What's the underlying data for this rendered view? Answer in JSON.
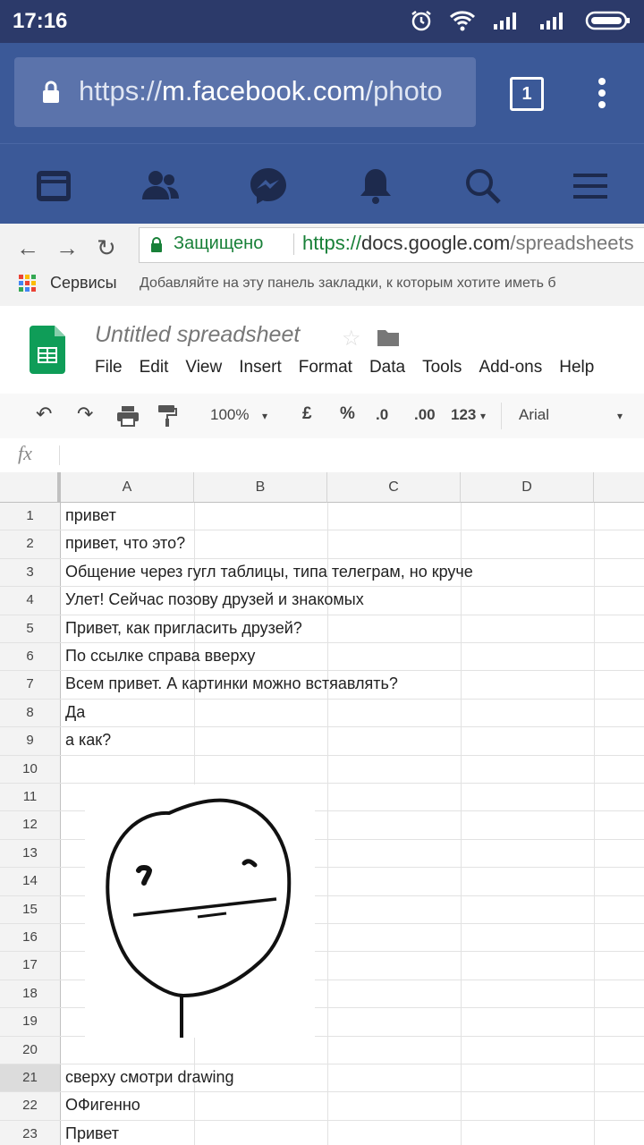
{
  "status_bar": {
    "time": "17:16"
  },
  "browser": {
    "url_prefix": "https://",
    "url_host": "m.facebook.com",
    "url_path": "/photo",
    "tab_count": "1"
  },
  "fb_nav": [
    "news-feed-icon",
    "friends-icon",
    "messenger-icon",
    "notifications-icon",
    "search-icon",
    "menu-icon"
  ],
  "chrome": {
    "secure_label": "Защищено",
    "url_prefix": "https://",
    "url_host": "docs.google.com",
    "url_path": "/spreadsheets",
    "bookmark_apps": "Сервисы",
    "bookmark_hint": "Добавляйте на эту панель закладки, к которым хотите иметь б"
  },
  "sheet": {
    "title": "Untitled spreadsheet",
    "menu": [
      "File",
      "Edit",
      "View",
      "Insert",
      "Format",
      "Data",
      "Tools",
      "Add-ons",
      "Help"
    ],
    "toolbar": {
      "zoom": "100%",
      "currency": "£",
      "percent": "%",
      "dec_less": ".0",
      "dec_more": ".00",
      "more_formats": "123",
      "font": "Arial"
    },
    "fx_label": "fx",
    "columns": [
      "A",
      "B",
      "C",
      "D"
    ],
    "rows": [
      {
        "n": "1",
        "text": "привет"
      },
      {
        "n": "2",
        "text": "привет, что это?"
      },
      {
        "n": "3",
        "text": "Общение через гугл таблицы, типа телеграм, но круче"
      },
      {
        "n": "4",
        "text": "Улет! Сейчас позову друзей и знакомых"
      },
      {
        "n": "5",
        "text": "Привет, как пригласить друзей?"
      },
      {
        "n": "6",
        "text": "По ссылке справа вверху"
      },
      {
        "n": "7",
        "text": "Всем привет. А картинки можно встяавлять?"
      },
      {
        "n": "8",
        "text": "Да"
      },
      {
        "n": "9",
        "text": "а как?"
      },
      {
        "n": "10",
        "text": ""
      },
      {
        "n": "11",
        "text": ""
      },
      {
        "n": "12",
        "text": ""
      },
      {
        "n": "13",
        "text": ""
      },
      {
        "n": "14",
        "text": ""
      },
      {
        "n": "15",
        "text": ""
      },
      {
        "n": "16",
        "text": ""
      },
      {
        "n": "17",
        "text": ""
      },
      {
        "n": "18",
        "text": ""
      },
      {
        "n": "19",
        "text": ""
      },
      {
        "n": "20",
        "text": ""
      },
      {
        "n": "21",
        "text": "сверху смотри drawing"
      },
      {
        "n": "22",
        "text": "ОФигенно"
      },
      {
        "n": "23",
        "text": "Привет"
      }
    ],
    "selected_row": "21"
  },
  "colors": {
    "fb_blue": "#3b5998",
    "status_bg": "#2c3a6a",
    "secure_green": "#188038",
    "sheets_green": "#0f9d58"
  }
}
